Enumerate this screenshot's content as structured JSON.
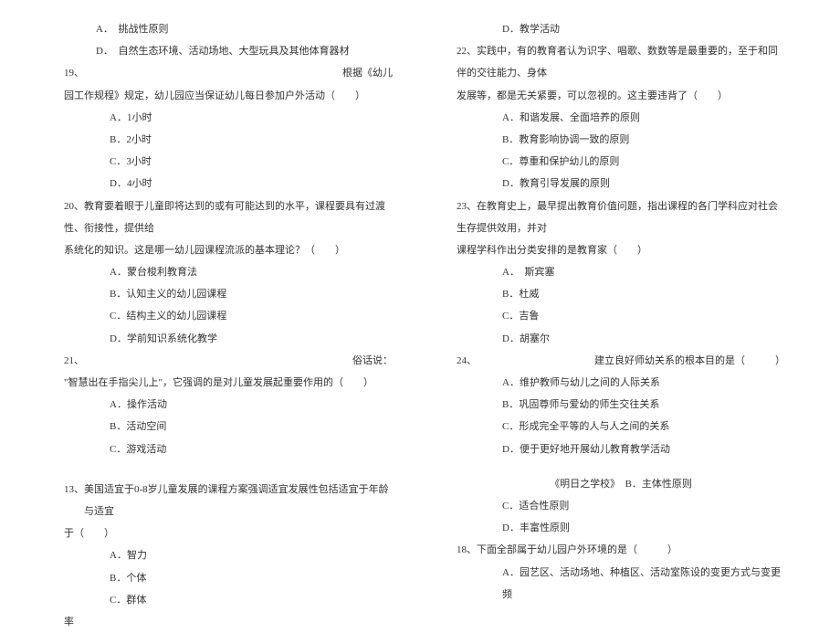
{
  "left": {
    "optA_top": "A．　挑战性原则",
    "optD_top": "D．　自然生态环境、活动场地、大型玩具及其他体育器材",
    "q19_num": "19、",
    "q19_right": "根据《幼儿",
    "q19_line2": "园工作规程》规定，幼儿园应当保证幼儿每日参加户外活动（　　）",
    "q19_a": "A．1小时",
    "q19_b": "B．2小时",
    "q19_c": "C．3小时",
    "q19_d": "D．4小时",
    "q20_l1": "20、教育要着眼于儿童即将达到的或有可能达到的水平，课程要具有过渡性、衔接性，提供给",
    "q20_l2": "系统化的知识。这是哪一幼儿园课程流派的基本理论？（　　）",
    "q20_a": "A．蒙台梭利教育法",
    "q20_b": "B．认知主义的幼儿园课程",
    "q20_c": "C．结构主义的幼儿园课程",
    "q20_d": "D．学前知识系统化教学",
    "q21_num": "21、",
    "q21_right": "俗话说：",
    "q21_l2": "\"智慧出在手指尖儿上\"，它强调的是对儿童发展起重要作用的（　　）",
    "q21_a": "A．操作活动",
    "q21_b": "B．活动空间",
    "q21_c": "C．游戏活动",
    "q13_num": "13、",
    "q13_right": "美国适宜于0-8岁儿童发展的课程方案强调适宜发展性包括适宜于年龄与适宜",
    "q13_l2": "于（　　）",
    "q13_a": "A．智力",
    "q13_b": "B．个体",
    "q13_c": "C．群体",
    "rate": "率"
  },
  "right": {
    "d_top": "D．教学活动",
    "q22_l1": "22、实践中，有的教育者认为识字、唱歌、数数等是最重要的，至于和同伴的交往能力、身体",
    "q22_l2": "发展等，都是无关紧要，可以忽视的。这主要违背了（　　）",
    "q22_a": "A．和谐发展、全面培养的原则",
    "q22_b": "B．教育影响协调一致的原则",
    "q22_c": "C．尊重和保护幼儿的原则",
    "q22_d": "D．教育引导发展的原则",
    "q23_l1": "23、在教育史上，最早提出教育价值问题，指出课程的各门学科应对社会生存提供效用，并对",
    "q23_l2": "课程学科作出分类安排的是教育家（　　）",
    "q23_a": "A．　斯宾塞",
    "q23_b": "B．杜威",
    "q23_c": "C．吉鲁",
    "q23_d": "D．胡塞尔",
    "q24_l1a": "24、",
    "q24_l1b": "建立良好师幼关系的根本目的是（　　　）",
    "q24_a": "A．维护教师与幼儿之间的人际关系",
    "q24_b": "B．巩固尊师与爱幼的师生交往关系",
    "q24_c": "C．形成完全平等的人与人之间的关系",
    "q24_d": "D．便于更好地开展幼儿教育教学活动",
    "book_b": "《明日之学校》　B．主体性原则",
    "optC_mid": "C．适合性原则",
    "optD_mid": "D．丰富性原则",
    "q18": "18、下面全部属于幼儿园户外环境的是（　　　）",
    "q18_a": "A．园艺区、活动场地、种植区、活动室陈设的变更方式与变更频"
  }
}
